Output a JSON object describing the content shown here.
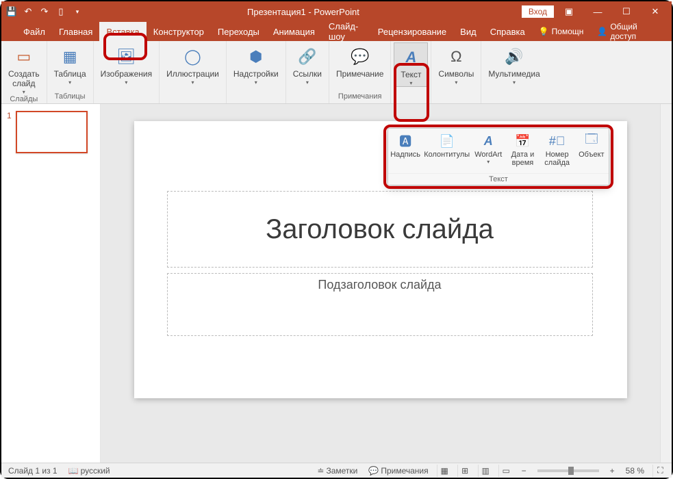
{
  "title": "Презентация1 - PowerPoint",
  "signin": "Вход",
  "tabs": {
    "file": "Файл",
    "home": "Главная",
    "insert": "Вставка",
    "design": "Конструктор",
    "transitions": "Переходы",
    "animation": "Анимация",
    "slideshow": "Слайд-шоу",
    "review": "Рецензирование",
    "view": "Вид",
    "help": "Справка",
    "tellme": "Помощн",
    "share": "Общий доступ"
  },
  "ribbon": {
    "new_slide": "Создать\nслайд",
    "slides_group": "Слайды",
    "table": "Таблица",
    "tables_group": "Таблицы",
    "images": "Изображения",
    "illustrations": "Иллюстрации",
    "addins": "Надстройки",
    "links": "Ссылки",
    "comment": "Примечание",
    "comments_group": "Примечания",
    "text": "Текст",
    "symbols": "Символы",
    "media": "Мультимедиа"
  },
  "popout": {
    "textbox": "Надпись",
    "headerfooter": "Колонтитулы",
    "wordart": "WordArt",
    "datetime": "Дата и\nвремя",
    "slidenum": "Номер\nслайда",
    "object": "Объект",
    "group": "Текст"
  },
  "slide": {
    "num": "1",
    "title_ph": "Заголовок слайда",
    "sub_ph": "Подзаголовок слайда"
  },
  "status": {
    "slide_of": "Слайд 1 из 1",
    "lang": "русский",
    "notes": "Заметки",
    "comments": "Примечания",
    "zoom": "58 %"
  }
}
